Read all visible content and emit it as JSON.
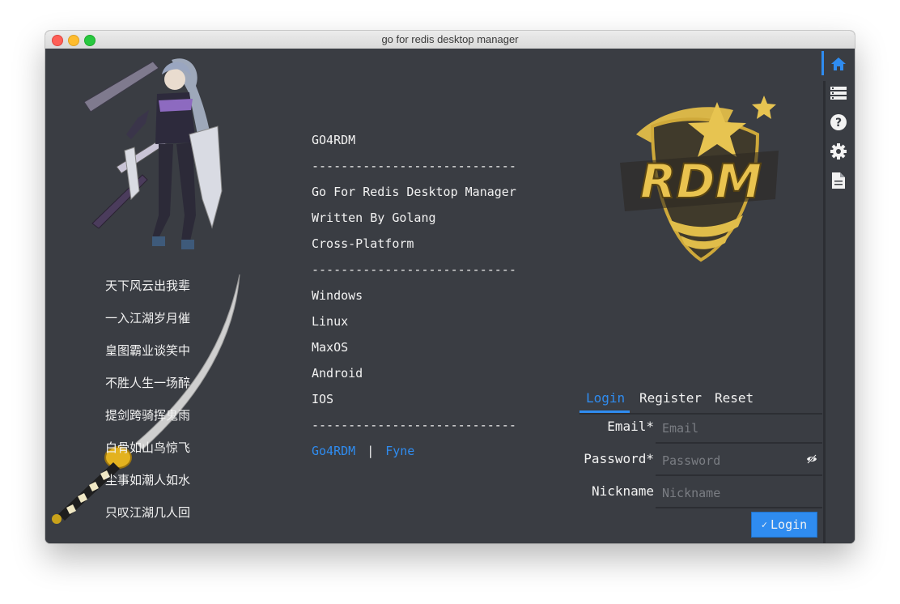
{
  "window": {
    "title": "go for redis desktop manager"
  },
  "poem": {
    "lines": [
      "天下风云出我辈",
      "一入江湖岁月催",
      "皇图霸业谈笑中",
      "不胜人生一场醉",
      "提剑跨骑挥鬼雨",
      "白骨如山鸟惊飞",
      "尘事如潮人如水",
      "只叹江湖几人回"
    ]
  },
  "info": {
    "lines": [
      "GO4RDM",
      "----------------------------",
      "Go For Redis Desktop Manager",
      "Written By Golang",
      "Cross-Platform",
      "----------------------------",
      "Windows",
      "Linux",
      "MaxOS",
      "Android",
      "IOS",
      "----------------------------"
    ],
    "links": {
      "go4rdm": "Go4RDM",
      "separator": "|",
      "fyne": "Fyne"
    }
  },
  "logo": {
    "text": "RDM"
  },
  "toolbar": {
    "items": [
      "home-icon",
      "server-list-icon",
      "help-icon",
      "settings-icon",
      "document-icon"
    ],
    "active": "home-icon"
  },
  "form": {
    "tabs": {
      "login": "Login",
      "register": "Register",
      "reset": "Reset",
      "active": "login"
    },
    "email": {
      "label": "Email*",
      "placeholder": "Email",
      "value": ""
    },
    "password": {
      "label": "Password*",
      "placeholder": "Password",
      "value": ""
    },
    "nickname": {
      "label": "Nickname",
      "placeholder": "Nickname",
      "value": ""
    },
    "submit": {
      "label": "Login"
    }
  },
  "colors": {
    "accent": "#2f8cf0",
    "background": "#3a3d43",
    "text": "#f2f2f2",
    "divider": "#2c2e33"
  }
}
